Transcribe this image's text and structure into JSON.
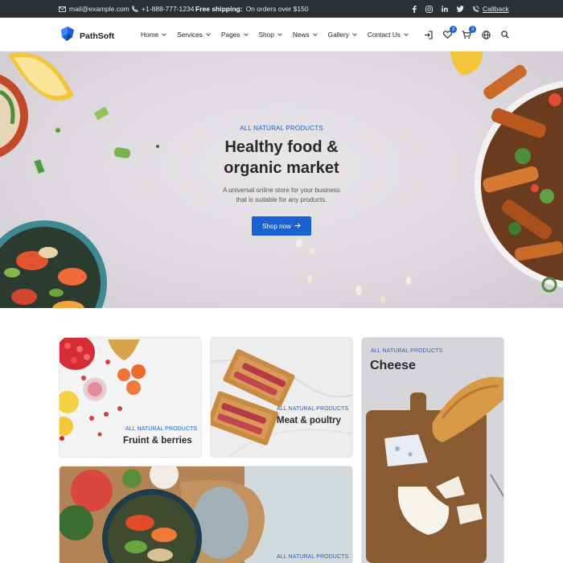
{
  "topbar": {
    "email": "mail@example.com",
    "phone": "+1-888-777-1234",
    "shipping_bold": "Free shipping:",
    "shipping_text": "On orders over $150",
    "social": [
      "facebook-icon",
      "instagram-icon",
      "linkedin-icon",
      "twitter-icon"
    ],
    "callback": "Callback"
  },
  "header": {
    "logo_text": "PathSoft",
    "nav": [
      {
        "label": "Home"
      },
      {
        "label": "Services"
      },
      {
        "label": "Pages"
      },
      {
        "label": "Shop"
      },
      {
        "label": "News"
      },
      {
        "label": "Gallery"
      },
      {
        "label": "Contact Us"
      }
    ],
    "wishlist_count": "3",
    "cart_count": "3",
    "accent": "#1b61d1"
  },
  "hero": {
    "eyebrow": "ALL NATURAL PRODUCTS",
    "title_line1": "Healthy food &",
    "title_line2": "organic market",
    "subtitle_line1": "A universal online store for your business",
    "subtitle_line2": "that is suitable for any products.",
    "cta": "Shop now"
  },
  "categories": [
    {
      "eyebrow": "ALL NATURAL PRODUCTS",
      "title": "Fruint & berries"
    },
    {
      "eyebrow": "ALL NATURAL PRODUCTS",
      "title": "Meat & poultry"
    },
    {
      "eyebrow": "ALL NATURAL PRODUCTS",
      "title": "Cheese"
    },
    {
      "eyebrow": "ALL NATURAL PRODUCTS",
      "title": ""
    }
  ]
}
